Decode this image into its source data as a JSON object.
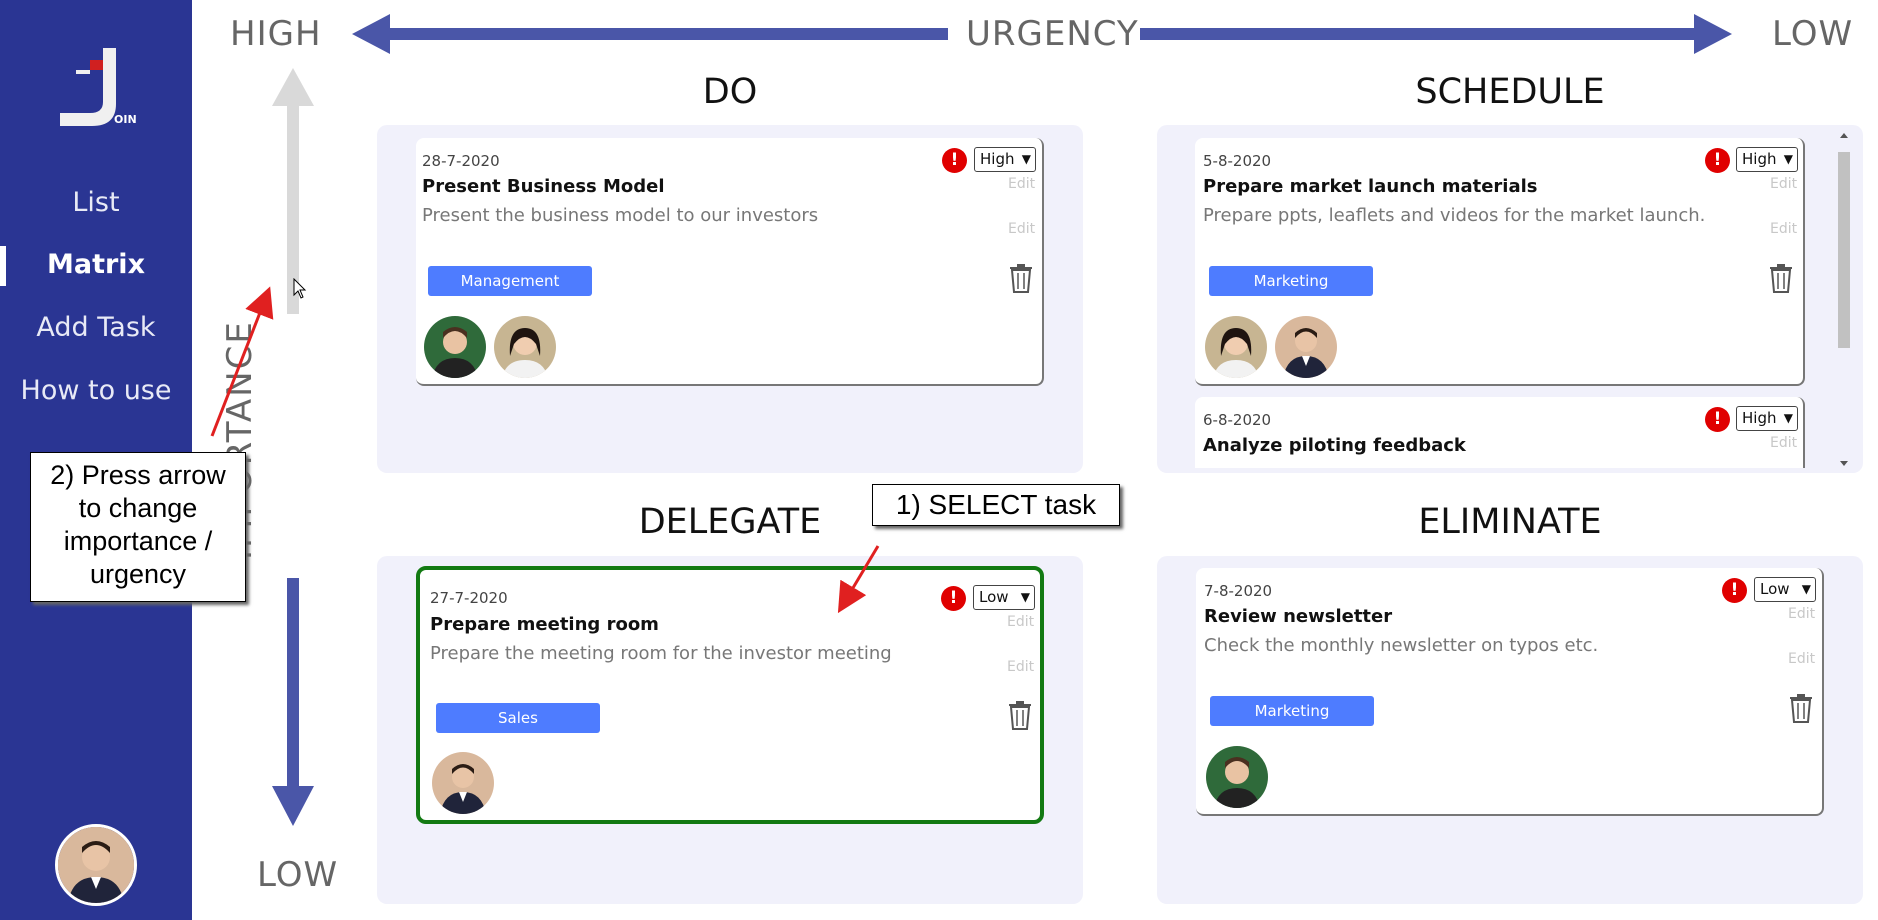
{
  "sidebar": {
    "logo_letters": "OIN",
    "nav": [
      {
        "label": "List"
      },
      {
        "label": "Matrix"
      },
      {
        "label": "Add Task"
      },
      {
        "label": "How to use"
      }
    ]
  },
  "axes": {
    "urgency": "URGENCY",
    "urgency_high": "HIGH",
    "urgency_low": "LOW",
    "importance": "IMPORTANCE",
    "importance_low": "LOW"
  },
  "quadrants": {
    "do": {
      "title": "DO",
      "cards": [
        {
          "date": "28-7-2020",
          "title": "Present Business Model",
          "desc": "Present the business model to our investors",
          "tag": "Management",
          "priority": "High",
          "edit": "Edit"
        }
      ]
    },
    "schedule": {
      "title": "SCHEDULE",
      "cards": [
        {
          "date": "5-8-2020",
          "title": "Prepare market launch materials",
          "desc": "Prepare ppts, leaflets and videos for the market launch.",
          "tag": "Marketing",
          "priority": "High",
          "edit": "Edit"
        },
        {
          "date": "6-8-2020",
          "title": "Analyze piloting feedback",
          "priority": "High",
          "edit": "Edit"
        }
      ]
    },
    "delegate": {
      "title": "DELEGATE",
      "cards": [
        {
          "date": "27-7-2020",
          "title": "Prepare meeting room",
          "desc": "Prepare the meeting room for the investor meeting",
          "tag": "Sales",
          "priority": "Low",
          "edit": "Edit"
        }
      ]
    },
    "eliminate": {
      "title": "ELIMINATE",
      "cards": [
        {
          "date": "7-8-2020",
          "title": "Review newsletter",
          "desc": "Check the monthly newsletter on typos etc.",
          "tag": "Marketing",
          "priority": "Low",
          "edit": "Edit"
        }
      ]
    }
  },
  "annotations": {
    "select_task": "1) SELECT task",
    "press_arrow": "2) Press arrow to change importance / urgency"
  },
  "colors": {
    "sidebar": "#2a3593",
    "arrow": "#4a56a8",
    "tag": "#4e7cff",
    "alert": "#e00000",
    "selected_border": "#137a13",
    "quadrant_bg": "#f1f1fb"
  }
}
